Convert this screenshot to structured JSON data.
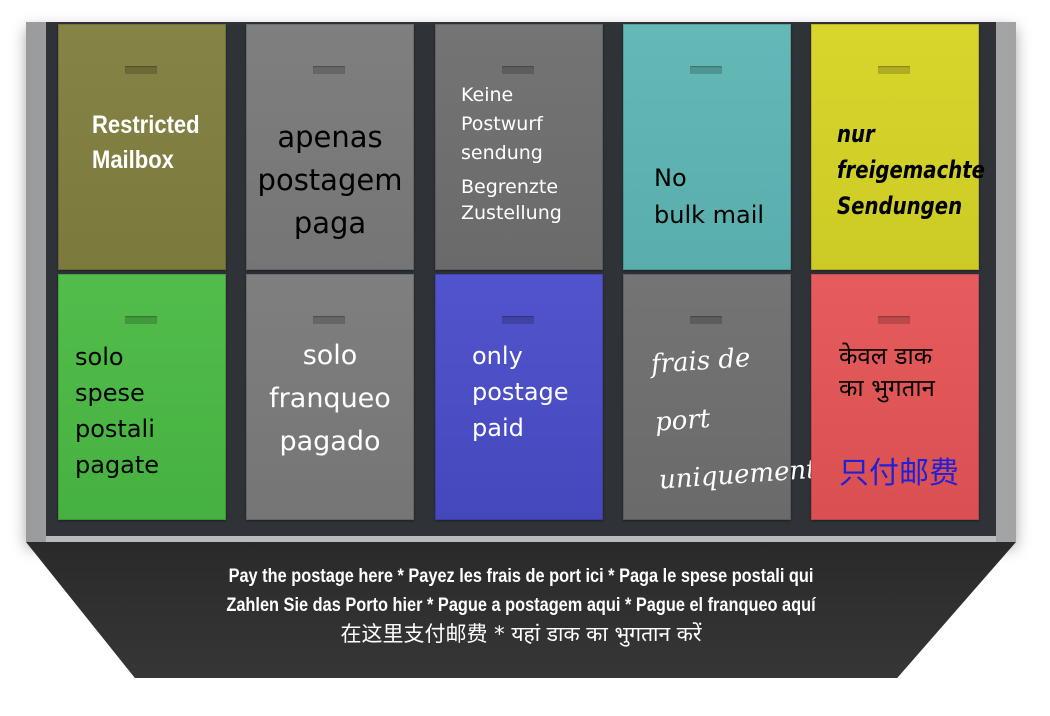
{
  "mailboxes": {
    "row1": [
      {
        "label": "Restricted\nMailbox",
        "color": "#7f7e3e"
      },
      {
        "label": "apenas\npostagem\npaga",
        "color": "#7a7a7a"
      },
      {
        "label": "Keine\nPostwurf\nsendung",
        "label2": "Begrenzte\nZustellung",
        "color": "#6e6e6e"
      },
      {
        "label": "No\nbulk mail",
        "color": "#5fb3b1"
      },
      {
        "label": "nur\nfreigemachte\nSendungen",
        "color": "#cfcf2a"
      }
    ],
    "row2": [
      {
        "label": "solo\nspese\npostali\npagate",
        "color": "#4cb746"
      },
      {
        "label": "solo\nfranqueo\npagado",
        "color": "#7a7a7a"
      },
      {
        "label": "only\npostage\npaid",
        "color": "#4b4ec4"
      },
      {
        "label": "frais de\nport\nuniquement",
        "color": "#6e6e6e"
      },
      {
        "label": "केवल डाक\nका भुगतान",
        "label2": "只付邮费",
        "color": "#e05656"
      }
    ]
  },
  "panel": {
    "line1": "Pay the postage here * Payez les frais de port ici * Paga le spese postali qui",
    "line2": "Zahlen Sie das Porto hier * Pague a postagem aqui * Pague el franqueo aquí",
    "line3": "在这里支付邮费 * यहां डाक का भुगतान करें"
  }
}
